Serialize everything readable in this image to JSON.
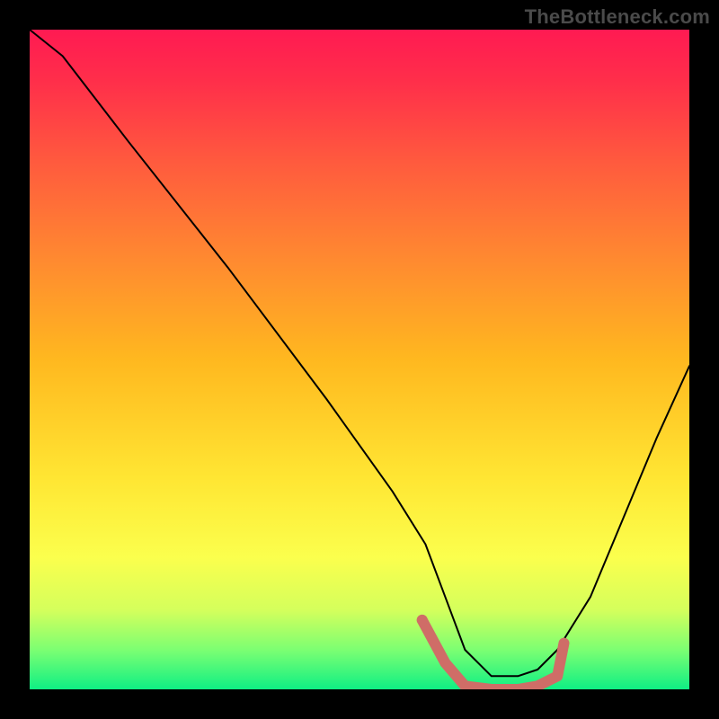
{
  "watermark": "TheBottleneck.com",
  "chart_data": {
    "type": "line",
    "title": "",
    "xlabel": "",
    "ylabel": "",
    "xlim": [
      0,
      100
    ],
    "ylim": [
      0,
      100
    ],
    "grid": false,
    "legend": false,
    "background_gradient": {
      "stops": [
        {
          "pos": 0.0,
          "color": "#ff1a52"
        },
        {
          "pos": 0.5,
          "color": "#ffb81f"
        },
        {
          "pos": 0.8,
          "color": "#fbff4d"
        },
        {
          "pos": 1.0,
          "color": "#0fef84"
        }
      ]
    },
    "series": [
      {
        "name": "bottleneck-curve",
        "x": [
          0,
          5,
          15,
          30,
          45,
          55,
          60,
          63,
          66,
          70,
          74,
          77,
          80,
          85,
          90,
          95,
          100
        ],
        "y": [
          100,
          96,
          83,
          64,
          44,
          30,
          22,
          14,
          6,
          2,
          2,
          3,
          6,
          14,
          26,
          38,
          49
        ]
      }
    ],
    "markers": {
      "name": "highlight-band",
      "color": "#cf6d67",
      "x": [
        59.5,
        63,
        66,
        70,
        74,
        77,
        80,
        81
      ],
      "y": [
        10.5,
        4,
        0.5,
        0,
        0,
        0.5,
        2,
        7
      ]
    }
  }
}
